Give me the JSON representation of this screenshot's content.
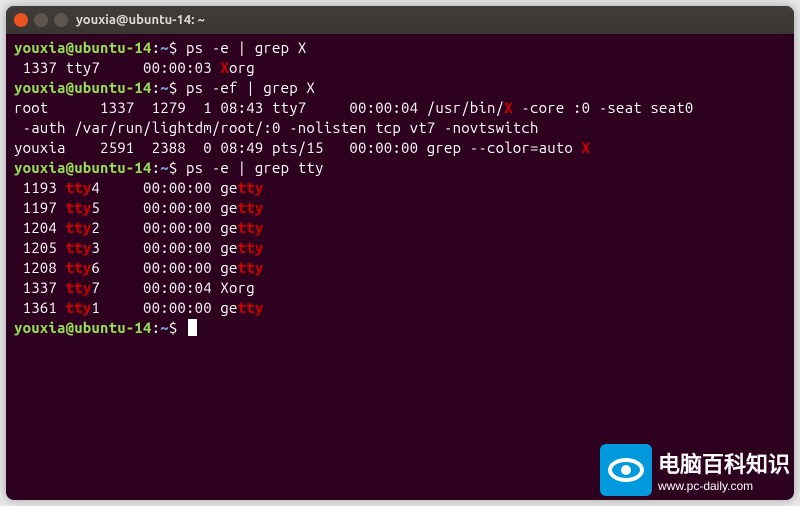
{
  "window": {
    "title": "youxia@ubuntu-14: ~"
  },
  "prompt": {
    "user_host": "youxia@ubuntu-14",
    "colon": ":",
    "path": "~",
    "symbol": "$"
  },
  "sessions": [
    {
      "command": "ps -e | grep X",
      "output_lines": [
        {
          "segments": [
            {
              "t": " 1337 tty7     00:00:03 "
            },
            {
              "t": "X",
              "hl": true
            },
            {
              "t": "org"
            }
          ]
        }
      ]
    },
    {
      "command": "ps -ef | grep X",
      "output_lines": [
        {
          "segments": [
            {
              "t": "root      1337  1279  1 08:43 tty7     00:00:04 /usr/bin/"
            },
            {
              "t": "X",
              "hl": true
            },
            {
              "t": " -core :0 -seat seat0"
            }
          ]
        },
        {
          "segments": [
            {
              "t": " -auth /var/run/lightdm/root/:0 -nolisten tcp vt7 -novtswitch"
            }
          ]
        },
        {
          "segments": [
            {
              "t": "youxia    2591  2388  0 08:49 pts/15   00:00:00 grep --color=auto "
            },
            {
              "t": "X",
              "hl": true
            }
          ]
        }
      ]
    },
    {
      "command": "ps -e | grep tty",
      "output_lines": [
        {
          "segments": [
            {
              "t": " 1193 "
            },
            {
              "t": "tty",
              "hl": true
            },
            {
              "t": "4     00:00:00 ge"
            },
            {
              "t": "tty",
              "hl": true
            }
          ]
        },
        {
          "segments": [
            {
              "t": " 1197 "
            },
            {
              "t": "tty",
              "hl": true
            },
            {
              "t": "5     00:00:00 ge"
            },
            {
              "t": "tty",
              "hl": true
            }
          ]
        },
        {
          "segments": [
            {
              "t": " 1204 "
            },
            {
              "t": "tty",
              "hl": true
            },
            {
              "t": "2     00:00:00 ge"
            },
            {
              "t": "tty",
              "hl": true
            }
          ]
        },
        {
          "segments": [
            {
              "t": " 1205 "
            },
            {
              "t": "tty",
              "hl": true
            },
            {
              "t": "3     00:00:00 ge"
            },
            {
              "t": "tty",
              "hl": true
            }
          ]
        },
        {
          "segments": [
            {
              "t": " 1208 "
            },
            {
              "t": "tty",
              "hl": true
            },
            {
              "t": "6     00:00:00 ge"
            },
            {
              "t": "tty",
              "hl": true
            }
          ]
        },
        {
          "segments": [
            {
              "t": " 1337 "
            },
            {
              "t": "tty",
              "hl": true
            },
            {
              "t": "7     00:00:04 Xorg"
            }
          ]
        },
        {
          "segments": [
            {
              "t": " 1361 "
            },
            {
              "t": "tty",
              "hl": true
            },
            {
              "t": "1     00:00:00 ge"
            },
            {
              "t": "tty",
              "hl": true
            }
          ]
        }
      ]
    },
    {
      "command": "",
      "output_lines": []
    }
  ],
  "watermark": {
    "main": "电脑百科知识",
    "url": "www.pc-daily.com"
  }
}
